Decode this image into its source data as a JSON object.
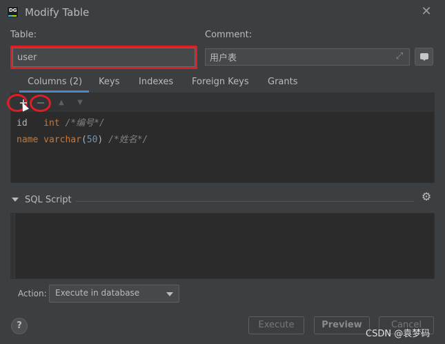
{
  "window": {
    "title": "Modify Table",
    "logo_text": "DG"
  },
  "form": {
    "table_label": "Table:",
    "table_value": "user",
    "comment_label": "Comment:",
    "comment_value": "用户表"
  },
  "tabs": [
    {
      "label": "Columns (2)",
      "selected": true
    },
    {
      "label": "Keys",
      "selected": false
    },
    {
      "label": "Indexes",
      "selected": false
    },
    {
      "label": "Foreign Keys",
      "selected": false
    },
    {
      "label": "Grants",
      "selected": false
    }
  ],
  "editor": {
    "lines": [
      {
        "name": "id",
        "type": "int",
        "comment": "/*编号*/"
      },
      {
        "name": "name",
        "type": "varchar",
        "size": "50",
        "comment": "/*姓名*/"
      }
    ]
  },
  "sql_section": {
    "title": "SQL Script"
  },
  "action": {
    "label": "Action:",
    "value": "Execute in database"
  },
  "buttons": {
    "help": "?",
    "execute": "Execute",
    "preview": "Preview",
    "cancel": "Cancel"
  },
  "watermark": "CSDN @袁梦码",
  "colors": {
    "highlight": "#e01e26",
    "tab_active": "#4a88c7",
    "keyword": "#cc7832",
    "number": "#6897bb",
    "comment": "#808080"
  },
  "icons": [
    "close-icon",
    "expand-icon",
    "comment-icon",
    "add-icon",
    "remove-icon",
    "arrow-up-icon",
    "arrow-down-icon",
    "settings-icon",
    "chevron-down-icon",
    "help-icon"
  ]
}
